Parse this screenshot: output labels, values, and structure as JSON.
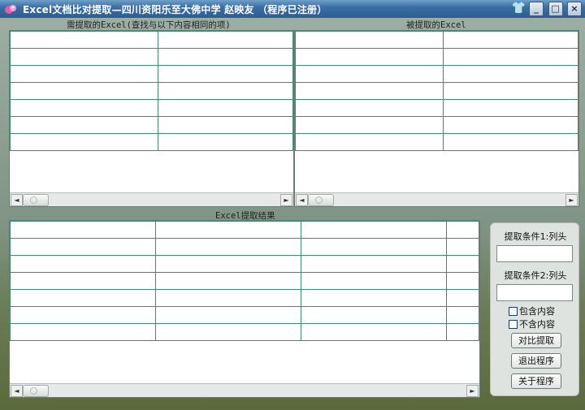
{
  "window": {
    "title": "Excel文档比对提取—四川资阳乐至大佛中学  赵映友    （程序已注册）",
    "controls": {
      "skin": "👕",
      "minimize": "_",
      "maximize": "□",
      "close": "×"
    }
  },
  "left_grid": {
    "label": "需提取的Excel(查找与以下内容相同的项)"
  },
  "right_grid": {
    "label": "被提取的Excel"
  },
  "result_grid": {
    "label": "Excel提取结果"
  },
  "side": {
    "cond1_label": "提取条件1:列头",
    "cond1_value": "",
    "cond2_label": "提取条件2:列头",
    "cond2_value": "",
    "contains_label": "包含内容",
    "not_contains_label": "不含内容",
    "compare_button": "对比提取",
    "exit_button": "退出程序",
    "about_button": "关于程序"
  },
  "scrollbar": {
    "left_arrow": "◄",
    "right_arrow": "►"
  },
  "colors": {
    "grid_line": "#3f8a72",
    "titlebar": "#2c5d93"
  }
}
